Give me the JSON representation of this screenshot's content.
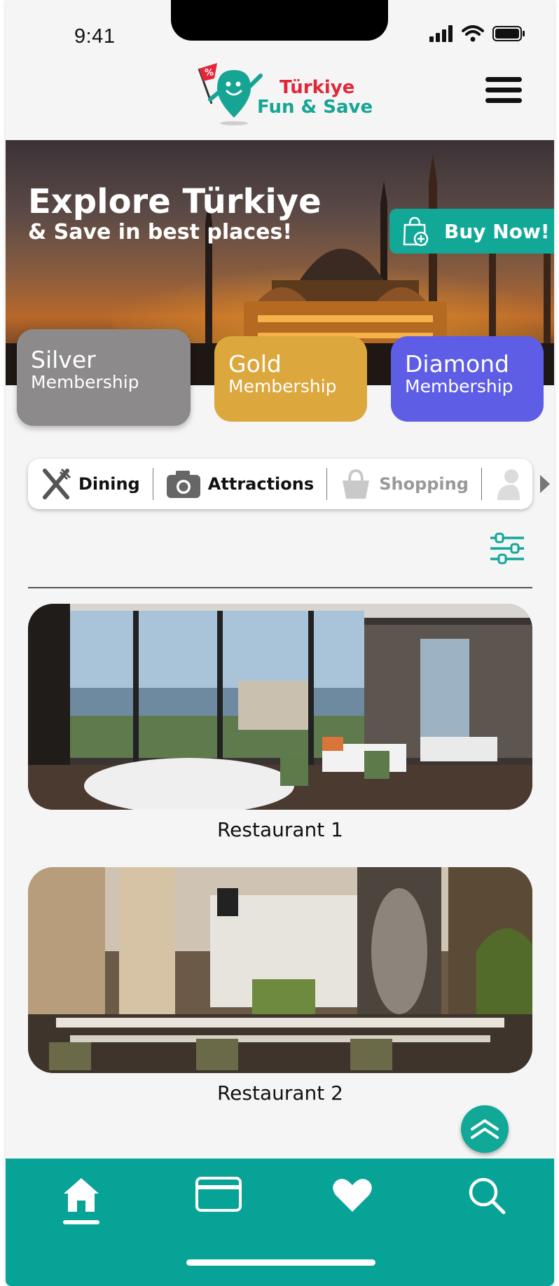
{
  "status_bar": {
    "time": "9:41"
  },
  "brand": {
    "line1": "Türkiye",
    "line2": "Fun & Save"
  },
  "hero": {
    "title": "Explore Türkiye",
    "subtitle": "& Save in best places!",
    "buy_label": "Buy Now!"
  },
  "memberships": [
    {
      "name": "Silver",
      "sub": "Membership",
      "color": "#8c8a8b"
    },
    {
      "name": "Gold",
      "sub": "Membership",
      "color": "#dca73c"
    },
    {
      "name": "Diamond",
      "sub": "Membership",
      "color": "#5e5de6"
    }
  ],
  "categories": [
    {
      "label": "Dining",
      "icon": "fork-knife-icon",
      "active": true
    },
    {
      "label": "Attractions",
      "icon": "camera-icon",
      "active": true
    },
    {
      "label": "Shopping",
      "icon": "shopping-bag-icon",
      "active": false
    },
    {
      "label": "",
      "icon": "person-icon",
      "active": false
    }
  ],
  "restaurants": [
    {
      "name": "Restaurant 1"
    },
    {
      "name": "Restaurant 2"
    }
  ],
  "bottom_nav": [
    {
      "icon": "home-icon",
      "active": true
    },
    {
      "icon": "card-icon",
      "active": false
    },
    {
      "icon": "heart-icon",
      "active": false
    },
    {
      "icon": "search-icon",
      "active": false
    }
  ],
  "colors": {
    "accent": "#06a396",
    "brand_red": "#e0283a"
  }
}
